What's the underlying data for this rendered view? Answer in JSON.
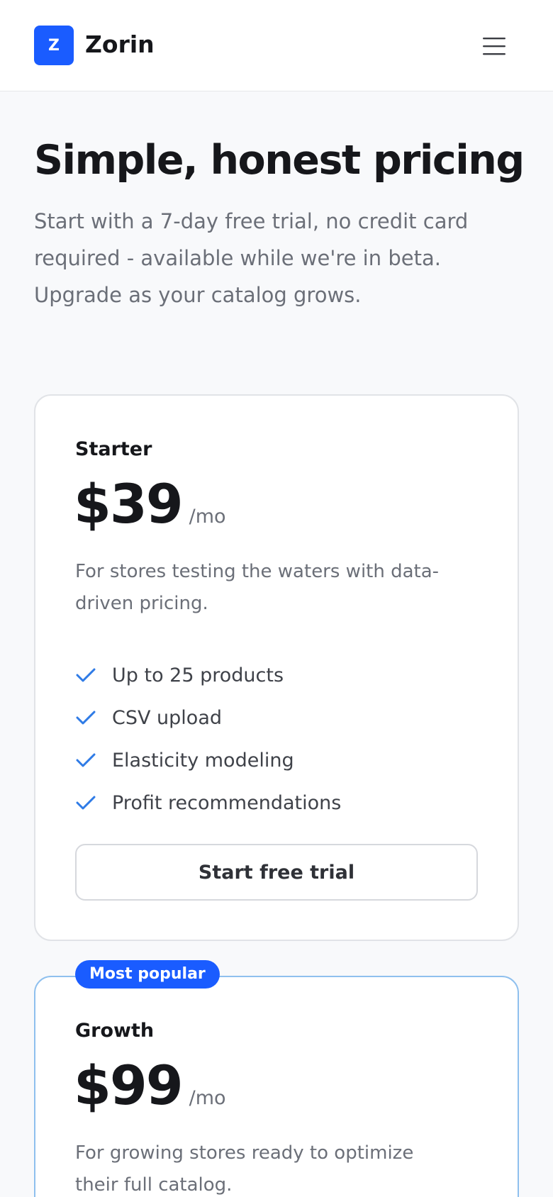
{
  "header": {
    "logo_letter": "Z",
    "brand_name": "Zorin",
    "menu_icon": "hamburger-menu-icon"
  },
  "hero": {
    "title": "Simple, honest pricing",
    "subtitle": "Start with a 7-day free trial, no credit card required - available while we're in beta. Upgrade as your catalog grows."
  },
  "plans": [
    {
      "name": "Starter",
      "price": "$39",
      "period": "/mo",
      "description": "For stores testing the waters with data-driven pricing.",
      "features": [
        "Up to 25 products",
        "CSV upload",
        "Elasticity modeling",
        "Profit recommendations"
      ],
      "cta_label": "Start free trial"
    },
    {
      "badge": "Most popular",
      "name": "Growth",
      "price": "$99",
      "period": "/mo",
      "description": "For growing stores ready to optimize their full catalog."
    }
  ],
  "colors": {
    "accent": "#1a5cff",
    "check": "#2f7be6",
    "popular_border": "#8fc0ee",
    "background": "#f8f9fb"
  },
  "icons": {
    "feature_check": "check-icon"
  }
}
